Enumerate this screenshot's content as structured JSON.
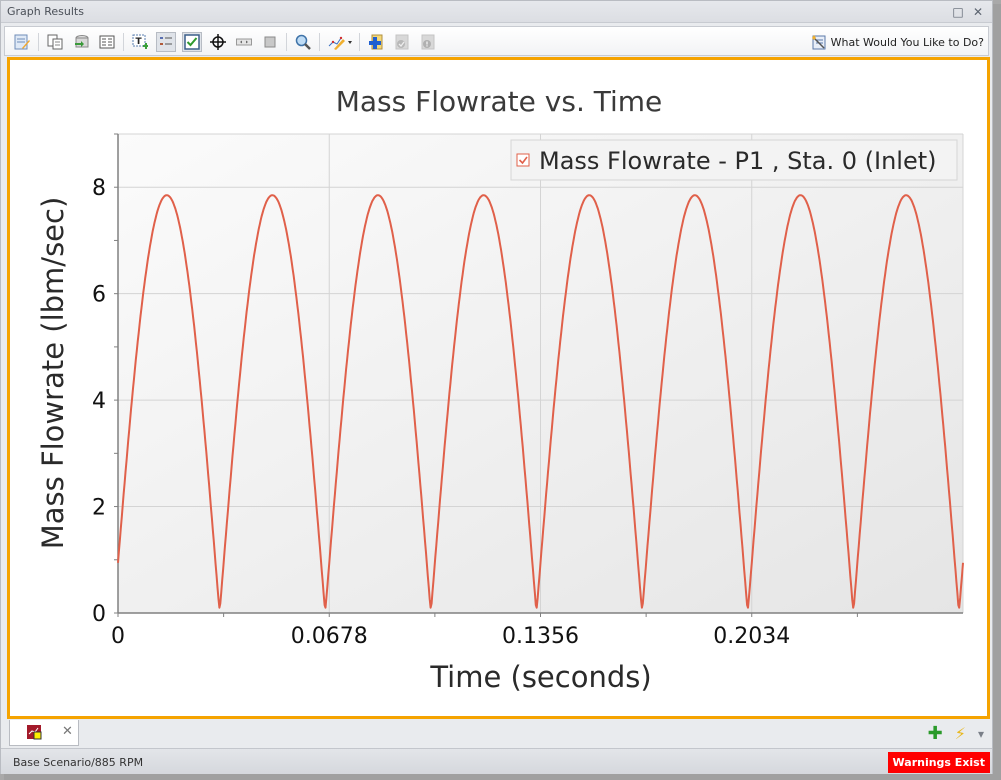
{
  "window": {
    "title": "Graph Results",
    "restore_icon": "□",
    "close_icon": "✕"
  },
  "toolbar": {
    "buttons": [
      {
        "name": "edit-graph-icon"
      },
      {
        "name": "copy-icon"
      },
      {
        "name": "export-icon"
      },
      {
        "name": "table-icon"
      },
      {
        "name": "add-text-icon"
      },
      {
        "name": "legend-icon"
      },
      {
        "name": "checkbox-icon"
      },
      {
        "name": "crosshair-icon"
      },
      {
        "name": "scroll-icon"
      },
      {
        "name": "stop-icon"
      },
      {
        "name": "zoom-icon"
      },
      {
        "name": "annotate-icon"
      },
      {
        "name": "add-folder-icon"
      },
      {
        "name": "check-disabled-icon"
      },
      {
        "name": "warning-disabled-icon"
      }
    ],
    "help_label": "What Would You Like to Do?"
  },
  "chart_data": {
    "type": "line",
    "title": "Mass Flowrate vs. Time",
    "xlabel": "Time (seconds)",
    "ylabel": "Mass Flowrate (lbm/sec)",
    "xlim": [
      0,
      0.2712
    ],
    "ylim": [
      0,
      9
    ],
    "x_ticks": [
      0,
      0.0678,
      0.1356,
      0.2034
    ],
    "x_tick_labels": [
      "0",
      "0.0678",
      "0.1356",
      "0.2034"
    ],
    "x_minor_ticks": [
      0.0339,
      0.1017,
      0.1695,
      0.2373
    ],
    "y_ticks": [
      0,
      2,
      4,
      6,
      8
    ],
    "y_tick_labels": [
      "0",
      "2",
      "4",
      "6",
      "8"
    ],
    "y_minor_ticks": [
      1,
      3,
      5,
      7
    ],
    "grid": true,
    "legend": {
      "position": "top-right",
      "checked": true
    },
    "series": [
      {
        "name": "Mass Flowrate - P1 , Sta. 0 (Inlet)",
        "color": "#e0604a",
        "shape": "rectified-sine",
        "amplitude": 7.85,
        "period": 0.0339,
        "phase_offset": 0.0013,
        "x": [
          0,
          0.0042,
          0.0085,
          0.0127,
          0.017,
          0.0212,
          0.0254,
          0.0297,
          0.0339,
          0.0381,
          0.0424,
          0.0466,
          0.0509,
          0.0551,
          0.0593,
          0.0636,
          0.0678,
          0.072,
          0.0763,
          0.0805,
          0.0848,
          0.089,
          0.0932,
          0.0975,
          0.1017,
          0.1059,
          0.1102,
          0.1144,
          0.1187,
          0.1229,
          0.1271,
          0.1314,
          0.1356,
          0.1398,
          0.1441,
          0.1483,
          0.1526,
          0.1568,
          0.161,
          0.1653,
          0.1695,
          0.1737,
          0.178,
          0.1822,
          0.1865,
          0.1907,
          0.1949,
          0.1992,
          0.2034,
          0.2076,
          0.2119,
          0.2161,
          0.2204,
          0.2246,
          0.2288,
          0.2331,
          0.2373,
          0.2415,
          0.2458,
          0.25,
          0.2543,
          0.2585,
          0.2627,
          0.267,
          0.2712
        ],
        "y": [
          0.3,
          3.3,
          6.0,
          7.5,
          7.85,
          7.3,
          5.8,
          3.2,
          0.15,
          3.1,
          5.8,
          7.4,
          7.85,
          7.3,
          5.6,
          3.0,
          0.1,
          3.0,
          5.7,
          7.3,
          7.85,
          7.3,
          5.6,
          3.0,
          0.1,
          3.0,
          5.7,
          7.3,
          7.85,
          7.3,
          5.6,
          3.0,
          0.1,
          3.0,
          5.7,
          7.3,
          7.85,
          7.3,
          5.6,
          3.0,
          0.1,
          3.0,
          5.7,
          7.3,
          7.85,
          7.3,
          5.6,
          3.0,
          0.1,
          3.0,
          5.7,
          7.3,
          7.85,
          7.3,
          5.6,
          3.0,
          0.1,
          3.0,
          5.7,
          7.3,
          7.85,
          7.3,
          5.6,
          3.0,
          0.3
        ]
      }
    ]
  },
  "tabs": [
    {
      "icon": "graph-tab-icon",
      "close_icon": "✕"
    }
  ],
  "tab_actions": {
    "add_icon": "✚",
    "quick_icon": "⚡",
    "menu_icon": "▾"
  },
  "status": {
    "scenario": "Base Scenario/885 RPM",
    "warning": "Warnings Exist",
    "warning_color": "#ff0000"
  }
}
